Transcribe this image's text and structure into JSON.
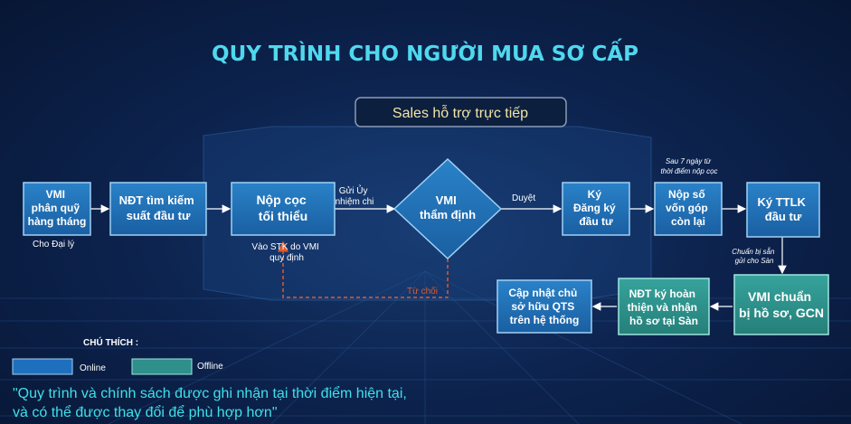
{
  "title": "QUY TRÌNH CHO NGƯỜI MUA SƠ CẤP",
  "sales_banner": "Sales hỗ trợ trực tiếp",
  "colors": {
    "online": "#2171b5",
    "offline": "#2f8f8a",
    "title": "#4fd8ee",
    "reject_arrow": "#e05a2b"
  },
  "nodes": {
    "vmi_quota": [
      "VMI",
      "phân quỹ",
      "hàng tháng"
    ],
    "ndt_search": [
      "NĐT tìm kiếm",
      "suất đầu tư"
    ],
    "deposit": [
      "Nộp cọc",
      "tối thiểu"
    ],
    "vmi_review": [
      "VMI",
      "thẩm định"
    ],
    "sign_register": [
      "Ký",
      "Đăng ký",
      "đầu tư"
    ],
    "pay_remaining": [
      "Nộp số",
      "vốn góp",
      "còn lại"
    ],
    "sign_ttlk": [
      "Ký TTLK",
      "đầu tư"
    ],
    "vmi_prepare": [
      "VMI chuẩn",
      "bị hồ sơ, GCN"
    ],
    "ndt_complete": [
      "NĐT ký hoàn",
      "thiện và nhận",
      "hồ sơ tại Sàn"
    ],
    "update_owner": [
      "Cập nhật chủ",
      "sở hữu QTS",
      "trên hệ thống"
    ]
  },
  "annotations": {
    "for_agency": "Cho Đại lý",
    "send_mandate": [
      "Gửi Ủy",
      "nhiệm chi"
    ],
    "transfer_note": [
      "Vào STK do VMI",
      "quy định"
    ],
    "approved": "Duyệt",
    "rejected": "Từ chối",
    "after_7_days": [
      "Sau 7 ngày từ",
      "thời điểm nộp cọc"
    ],
    "ready_note": [
      "Chuẩn bị sẵn",
      "gửi cho Sàn"
    ]
  },
  "legend": {
    "title": "CHÚ THÍCH :",
    "online": "Online",
    "offline": "Offline"
  },
  "quote": [
    "\"Quy trình và chính sách được ghi nhận tại thời điểm hiện tại,",
    "và có thể được thay đổi để phù hợp hơn\""
  ]
}
